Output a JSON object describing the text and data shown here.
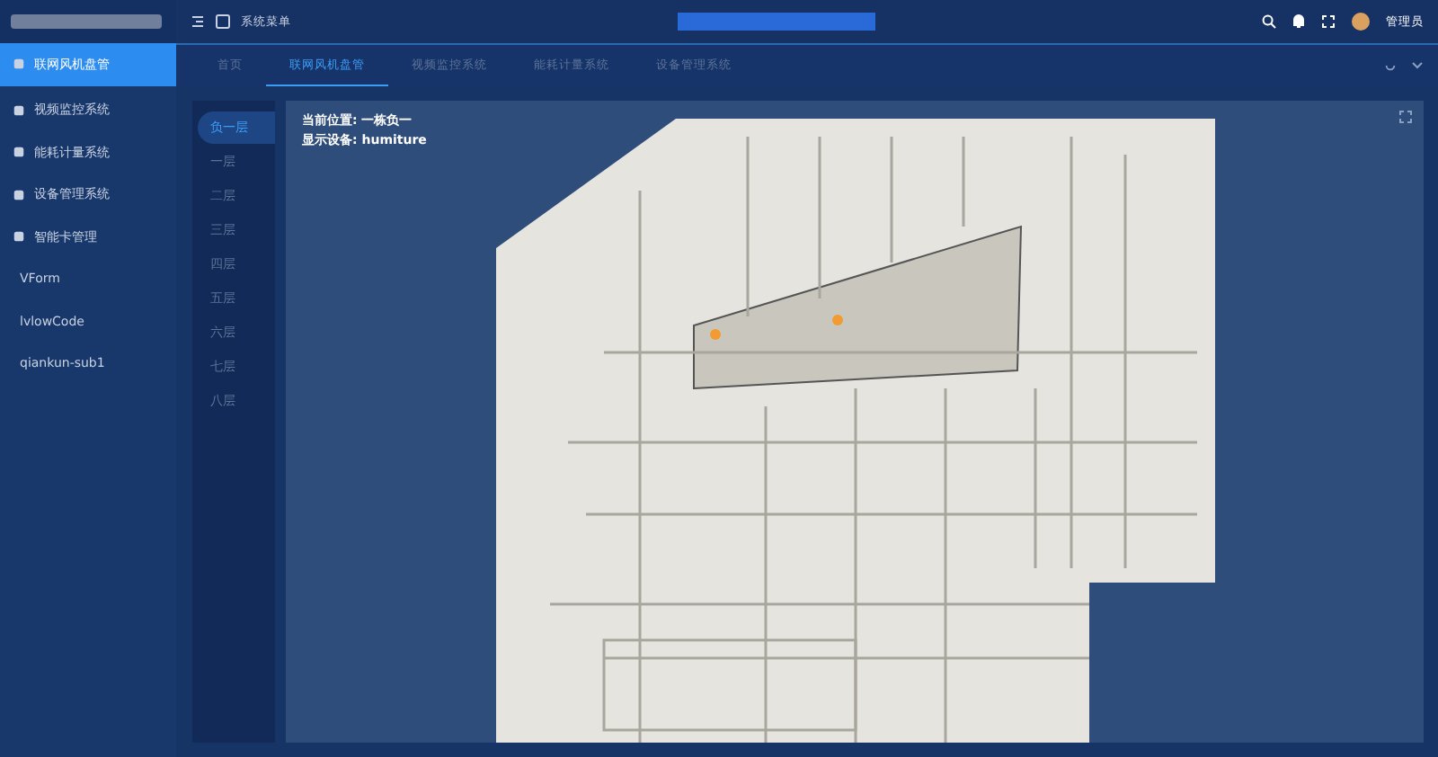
{
  "header": {
    "menu_title": "系统菜单",
    "user": "管理员"
  },
  "sidebar": {
    "items": [
      {
        "label": "联网风机盘管",
        "selected": true,
        "kind": "icon"
      },
      {
        "label": "视频监控系统",
        "selected": false,
        "kind": "icon"
      },
      {
        "label": "能耗计量系统",
        "selected": false,
        "kind": "icon"
      },
      {
        "label": "设备管理系统",
        "selected": false,
        "kind": "icon"
      },
      {
        "label": "智能卡管理",
        "selected": false,
        "kind": "icon"
      },
      {
        "label": "VForm",
        "selected": false,
        "kind": "plain"
      },
      {
        "label": "lvlowCode",
        "selected": false,
        "kind": "plain"
      },
      {
        "label": "qiankun-sub1",
        "selected": false,
        "kind": "plain"
      }
    ]
  },
  "tabs": [
    {
      "label": "首页",
      "selected": false
    },
    {
      "label": "联网风机盘管",
      "selected": true
    },
    {
      "label": "视频监控系统",
      "selected": false
    },
    {
      "label": "能耗计量系统",
      "selected": false
    },
    {
      "label": "设备管理系统",
      "selected": false
    }
  ],
  "floors": [
    {
      "label": "负一层",
      "selected": true
    },
    {
      "label": "一层",
      "selected": false
    },
    {
      "label": "二层",
      "selected": false
    },
    {
      "label": "三层",
      "selected": false
    },
    {
      "label": "四层",
      "selected": false
    },
    {
      "label": "五层",
      "selected": false
    },
    {
      "label": "六层",
      "selected": false
    },
    {
      "label": "七层",
      "selected": false
    },
    {
      "label": "八层",
      "selected": false
    }
  ],
  "map": {
    "location": "当前位置: 一栋负一",
    "device": "显示设备: humiture"
  }
}
